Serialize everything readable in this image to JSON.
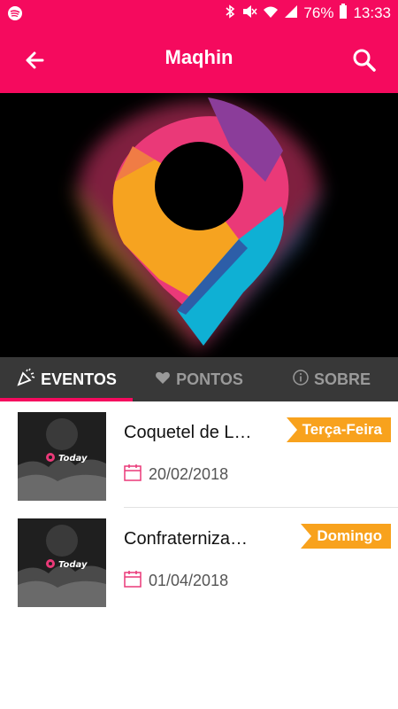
{
  "status_bar": {
    "battery": "76%",
    "time": "13:33"
  },
  "app_bar": {
    "title": "Maqhin"
  },
  "tabs": [
    {
      "label": "EVENTOS"
    },
    {
      "label": "PONTOS"
    },
    {
      "label": "SOBRE"
    }
  ],
  "events": [
    {
      "title": "Coquetel de L…",
      "day": "Terça-Feira",
      "date": "20/02/2018",
      "thumb_text": "Today"
    },
    {
      "title": "Confraterniza…",
      "day": "Domingo",
      "date": "01/04/2018",
      "thumb_text": "Today"
    }
  ],
  "colors": {
    "primary": "#f50a5e",
    "tab_bg": "#383838",
    "badge": "#f8a21d"
  }
}
